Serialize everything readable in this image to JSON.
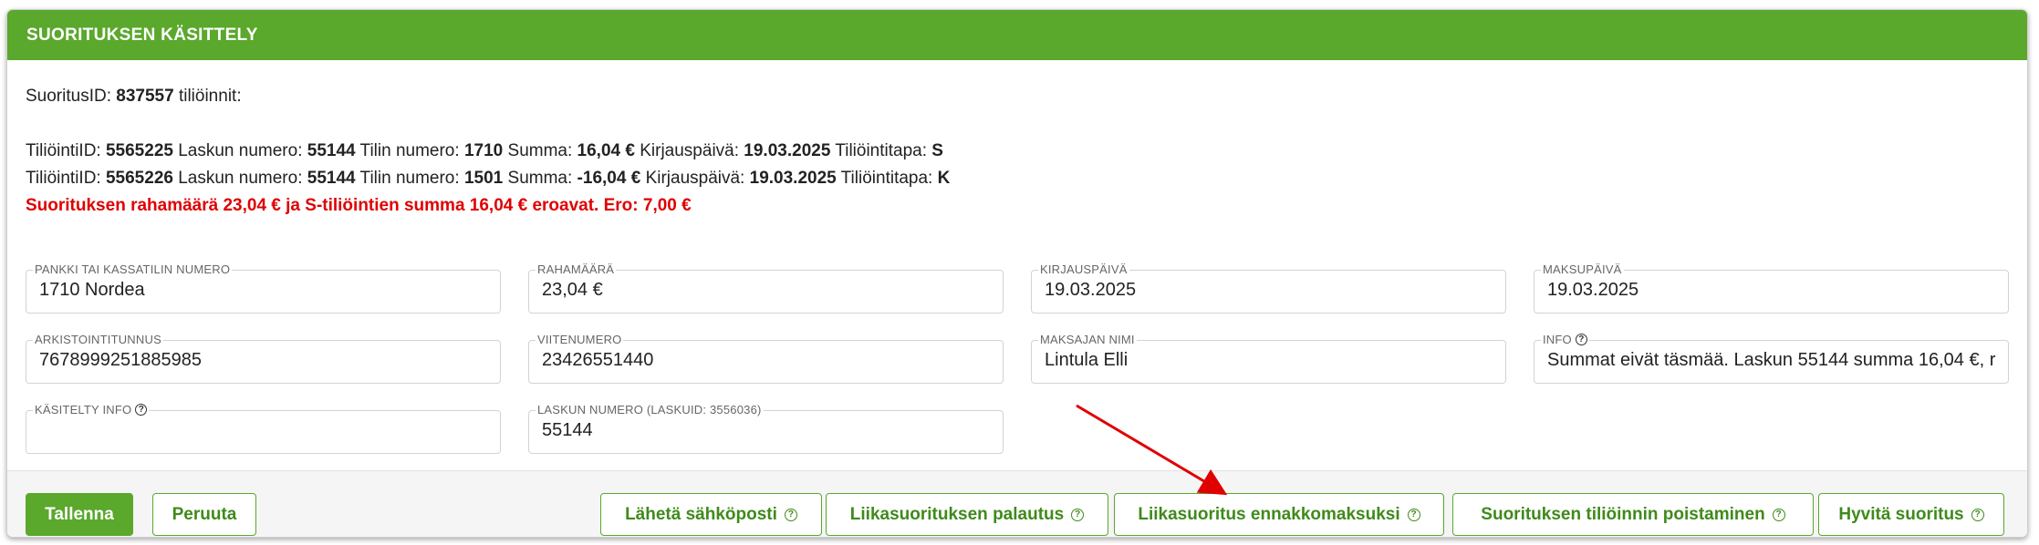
{
  "header": {
    "title": "SUORITUKSEN KÄSITTELY"
  },
  "summary": {
    "id_label": "SuoritusID:",
    "id_value": "837557",
    "id_suffix": "tiliöinnit:"
  },
  "postings": [
    {
      "id_label": "TiliöintiID:",
      "id_value": "5565225",
      "invoice_label": "Laskun numero:",
      "invoice_value": "55144",
      "account_label": "Tilin numero:",
      "account_value": "1710",
      "sum_label": "Summa:",
      "sum_value": "16,04 €",
      "date_label": "Kirjauspäivä:",
      "date_value": "19.03.2025",
      "type_label": "Tiliöintitapa:",
      "type_value": "S"
    },
    {
      "id_label": "TiliöintiID:",
      "id_value": "5565226",
      "invoice_label": "Laskun numero:",
      "invoice_value": "55144",
      "account_label": "Tilin numero:",
      "account_value": "1501",
      "sum_label": "Summa:",
      "sum_value": "-16,04 €",
      "date_label": "Kirjauspäivä:",
      "date_value": "19.03.2025",
      "type_label": "Tiliöintitapa:",
      "type_value": "K"
    }
  ],
  "warning": "Suorituksen rahamäärä 23,04 € ja S-tiliöintien summa 16,04 € eroavat. Ero: 7,00 €",
  "fields": {
    "bank": {
      "label": "PANKKI TAI KASSATILIN NUMERO",
      "value": "1710 Nordea"
    },
    "amount": {
      "label": "RAHAMÄÄRÄ",
      "value": "23,04 €"
    },
    "posting_date": {
      "label": "KIRJAUSPÄIVÄ",
      "value": "19.03.2025"
    },
    "payment_date": {
      "label": "MAKSUPÄIVÄ",
      "value": "19.03.2025"
    },
    "archive_id": {
      "label": "ARKISTOINTITUNNUS",
      "value": "7678999251885985"
    },
    "reference": {
      "label": "VIITENUMERO",
      "value": "23426551440"
    },
    "payer_name": {
      "label": "MAKSAJAN NIMI",
      "value": "Lintula Elli"
    },
    "info": {
      "label": "INFO",
      "value": "Summat eivät täsmää. Laskun 55144 summa 16,04 €, r"
    },
    "handled_info": {
      "label": "KÄSITELTY INFO",
      "value": ""
    },
    "invoice_number": {
      "label": "LASKUN NUMERO (LASKUID: 3556036)",
      "value": "55144"
    }
  },
  "buttons": {
    "save": "Tallenna",
    "cancel": "Peruuta",
    "send_email": "Lähetä sähköposti",
    "overpayment_refund": "Liikasuorituksen palautus",
    "overpayment_prepayment": "Liikasuoritus ennakkomaksuksi",
    "remove_posting": "Suorituksen tiliöinnin poistaminen",
    "credit_payment": "Hyvitä suoritus"
  },
  "help_glyph": "?",
  "colors": {
    "brand_green": "#5aa82c",
    "warning_red": "#e00000",
    "arrow_red": "#e00000"
  }
}
